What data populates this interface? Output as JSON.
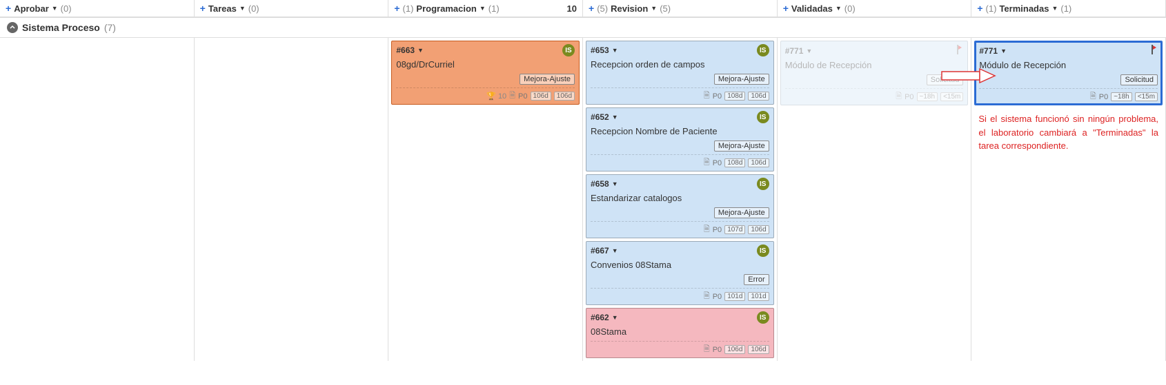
{
  "columns": [
    {
      "name": "Aprobar",
      "pre": "",
      "post": "(0)",
      "right": ""
    },
    {
      "name": "Tareas",
      "pre": "",
      "post": "(0)",
      "right": ""
    },
    {
      "name": "Programacion",
      "pre": "(1)",
      "post": "(1)",
      "right": "10"
    },
    {
      "name": "Revision",
      "pre": "(5)",
      "post": "(5)",
      "right": ""
    },
    {
      "name": "Validadas",
      "pre": "",
      "post": "(0)",
      "right": ""
    },
    {
      "name": "Terminadas",
      "pre": "(1)",
      "post": "(1)",
      "right": ""
    }
  ],
  "swimlane": {
    "name": "Sistema Proceso",
    "count": "(7)"
  },
  "cards": {
    "programacion": [
      {
        "id": "#663",
        "title": "08gd/DrCurriel",
        "tag": "Mejora-Ajuste",
        "avatar": "IS",
        "footerLeft": "🏆 10",
        "priority": "P0",
        "b1": "106d",
        "b2": "106d",
        "color": "orange",
        "hasTrophy": true
      }
    ],
    "revision": [
      {
        "id": "#653",
        "title": "Recepcion orden de campos",
        "tag": "Mejora-Ajuste",
        "avatar": "IS",
        "priority": "P0",
        "b1": "108d",
        "b2": "106d",
        "color": "blue"
      },
      {
        "id": "#652",
        "title": "Recepcion Nombre de Paciente",
        "tag": "Mejora-Ajuste",
        "avatar": "IS",
        "priority": "P0",
        "b1": "108d",
        "b2": "106d",
        "color": "blue"
      },
      {
        "id": "#658",
        "title": "Estandarizar catalogos",
        "tag": "Mejora-Ajuste",
        "avatar": "IS",
        "priority": "P0",
        "b1": "107d",
        "b2": "106d",
        "color": "blue"
      },
      {
        "id": "#667",
        "title": "Convenios 08Stama",
        "tag": "Error",
        "avatar": "IS",
        "priority": "P0",
        "b1": "101d",
        "b2": "101d",
        "color": "blue"
      },
      {
        "id": "#662",
        "title": "08Stama",
        "tag": "",
        "avatar": "IS",
        "priority": "P0",
        "b1": "106d",
        "b2": "106d",
        "color": "pink"
      }
    ],
    "validadas_ghost": {
      "id": "#771",
      "title": "Módulo de Recepción",
      "tag": "Solicitud",
      "priority": "P0",
      "b1": "~18h",
      "b2": "<15m"
    },
    "terminadas": [
      {
        "id": "#771",
        "title": "Módulo de Recepción",
        "tag": "Solicitud",
        "priority": "P0",
        "b1": "~18h",
        "b2": "<15m",
        "color": "blue"
      }
    ]
  },
  "note": "Si el sistema funcionó sin ningún problema, el laboratorio cambiará a \"Terminadas\" la tarea correspondiente."
}
